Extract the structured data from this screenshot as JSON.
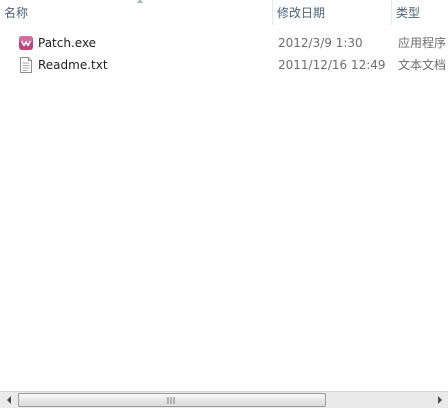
{
  "columns": {
    "name": "名称",
    "date": "修改日期",
    "type": "类型"
  },
  "files": [
    {
      "name": "Patch.exe",
      "date": "2012/3/9 1:30",
      "type": "应用程序",
      "icon": "application-icon"
    },
    {
      "name": "Readme.txt",
      "date": "2011/12/16 12:49",
      "type": "文本文档",
      "icon": "text-document-icon"
    }
  ],
  "scrollbar": {
    "orientation": "horizontal"
  },
  "colors": {
    "header_text": "#4c607a",
    "meta_text": "#6d6d6d",
    "app_icon": "#c4407e"
  }
}
